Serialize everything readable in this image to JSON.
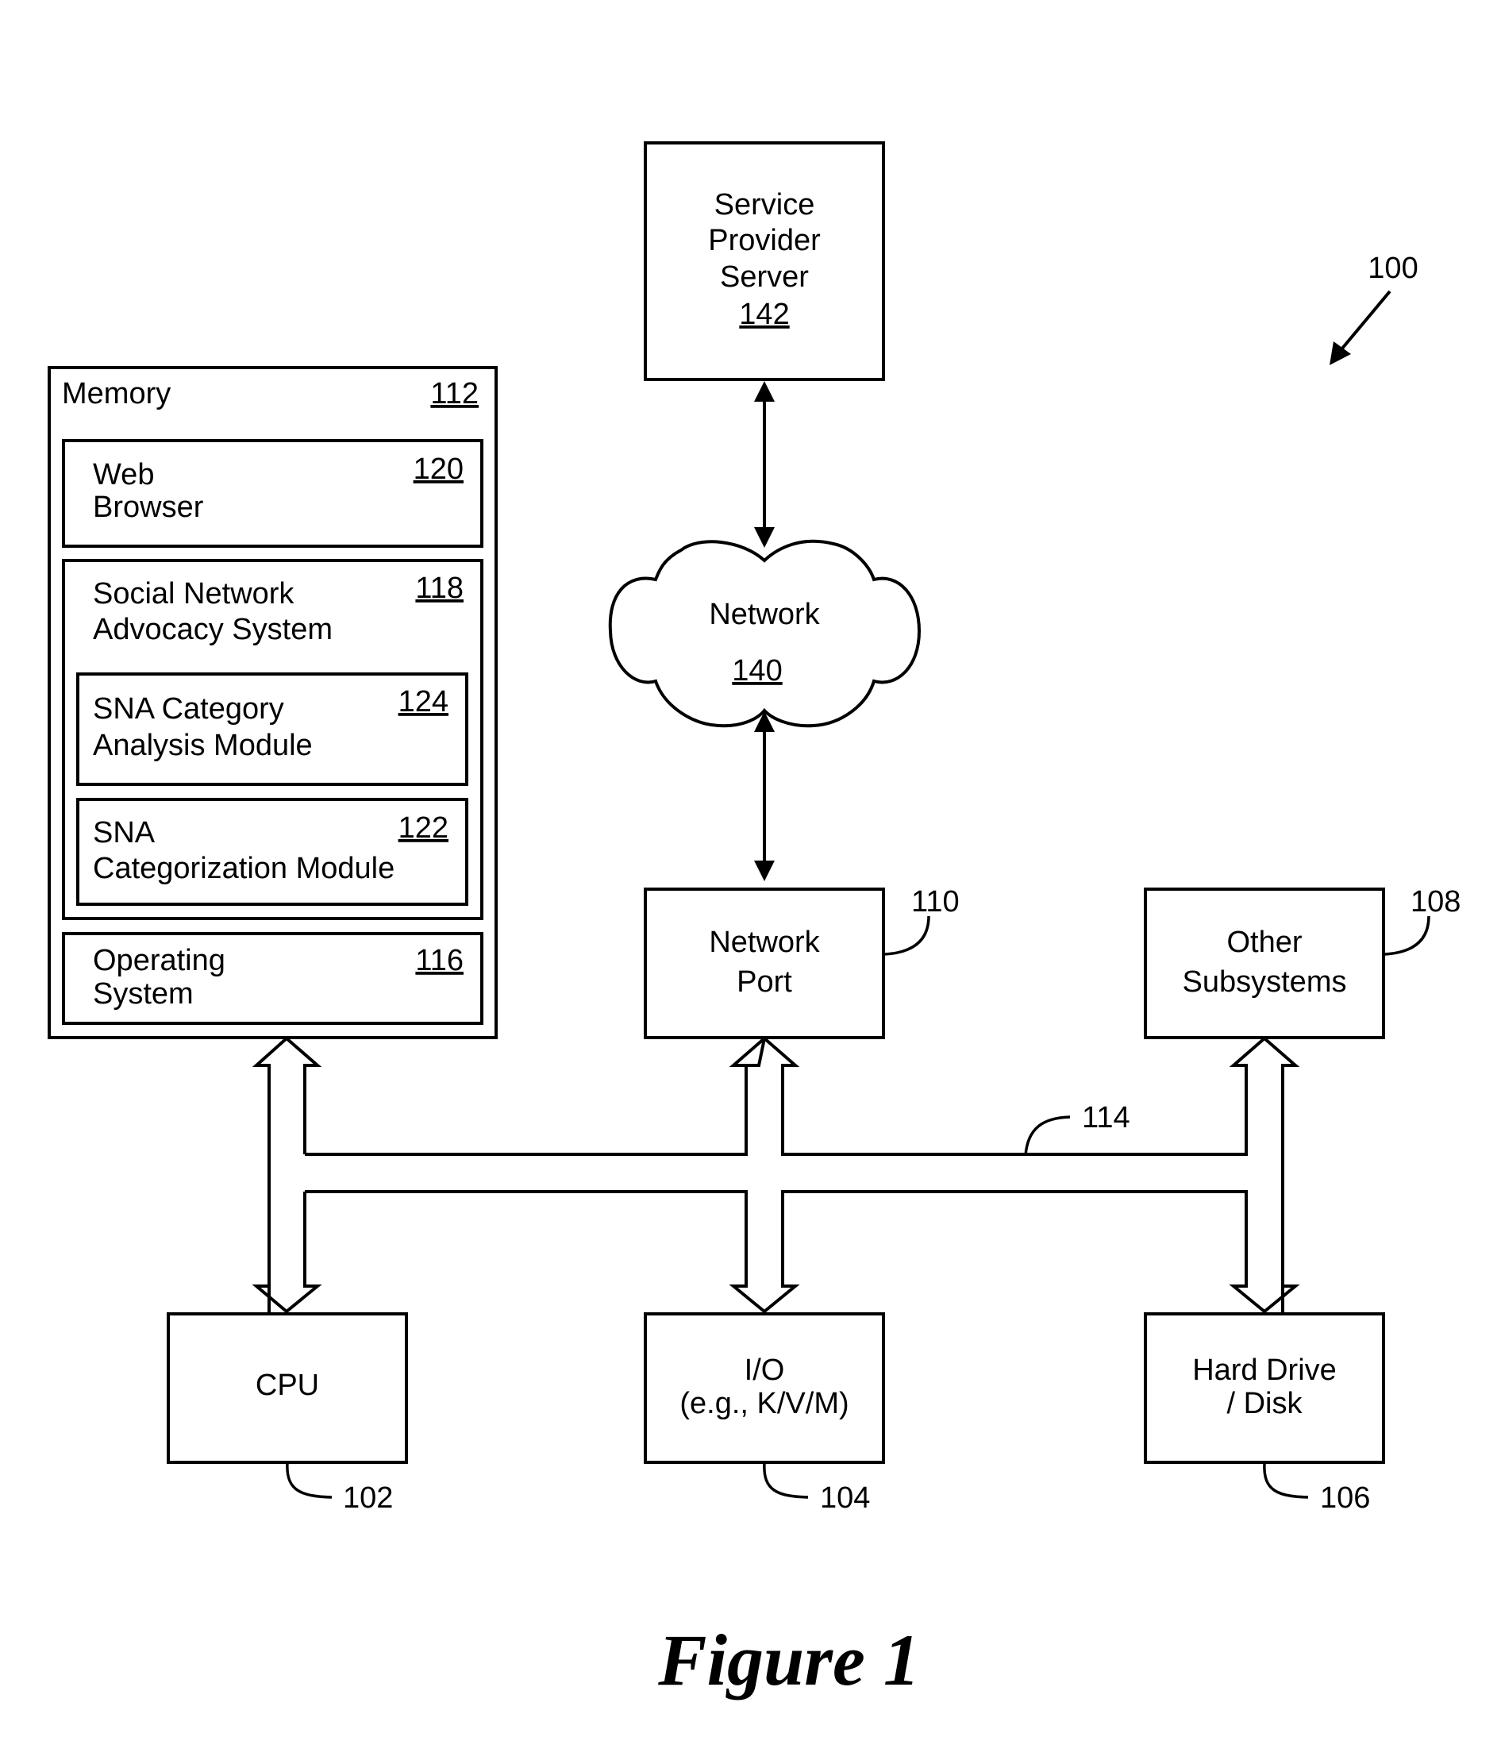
{
  "figure": {
    "caption": "Figure 1",
    "system_ref": "100"
  },
  "memory": {
    "title": "Memory",
    "ref": "112",
    "web_browser": {
      "line1": "Web",
      "line2": "Browser",
      "ref": "120"
    },
    "sna_system": {
      "line1": "Social Network",
      "line2": "Advocacy System",
      "ref": "118",
      "category_analysis": {
        "line1": "SNA Category",
        "line2": "Analysis Module",
        "ref": "124"
      },
      "categorization": {
        "line1": "SNA",
        "line2": "Categorization Module",
        "ref": "122"
      }
    },
    "operating_system": {
      "line1": "Operating",
      "line2": "System",
      "ref": "116"
    }
  },
  "service_provider": {
    "line1": "Service",
    "line2": "Provider",
    "line3": "Server",
    "ref": "142"
  },
  "network": {
    "label": "Network",
    "ref": "140"
  },
  "network_port": {
    "line1": "Network",
    "line2": "Port",
    "ref": "110"
  },
  "other_subsystems": {
    "line1": "Other",
    "line2": "Subsystems",
    "ref": "108"
  },
  "bus": {
    "ref": "114"
  },
  "cpu": {
    "label": "CPU",
    "ref": "102"
  },
  "io": {
    "line1": "I/O",
    "line2": "(e.g., K/V/M)",
    "ref": "104"
  },
  "hard_drive": {
    "line1": "Hard Drive",
    "line2": "/ Disk",
    "ref": "106"
  }
}
